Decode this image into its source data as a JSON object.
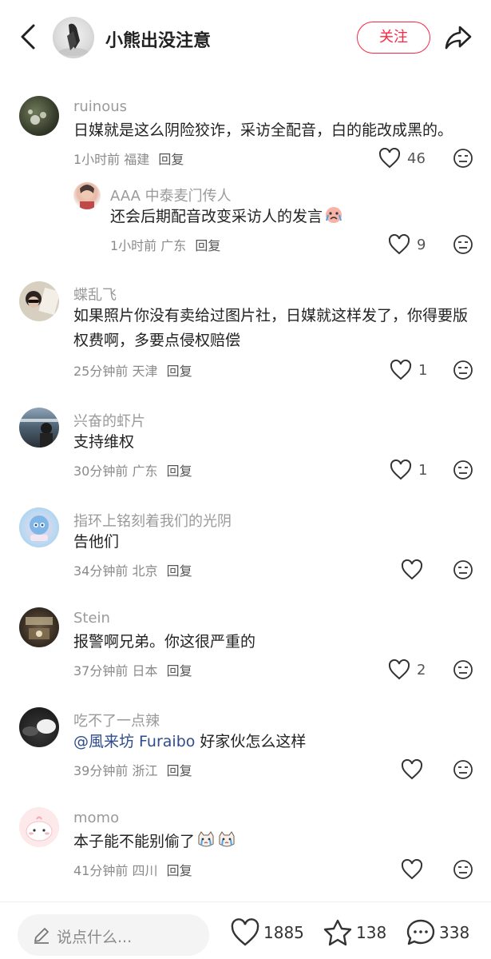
{
  "header": {
    "author_name": "小熊出没注意",
    "follow_label": "关注",
    "accent": "#ff2442"
  },
  "comments": [
    {
      "username": "ruinous",
      "text": "日媒就是这么阴险狡诈，采访全配音，白的能改成黑的。",
      "time": "1小时前",
      "location": "福建",
      "reply": "回复",
      "likes": "46",
      "replies": [
        {
          "username": "AAA 中泰麦门传人",
          "text": "还会后期配音改变采访人的发言",
          "emoji": "crying-face",
          "time": "1小时前",
          "location": "广东",
          "reply": "回复",
          "likes": "9"
        }
      ]
    },
    {
      "username": "蝶乱飞",
      "text": "如果照片你没有卖给过图片社，日媒就这样发了，你得要版权费啊，多要点侵权赔偿",
      "time": "25分钟前",
      "location": "天津",
      "reply": "回复",
      "likes": "1"
    },
    {
      "username": "兴奋的虾片",
      "text": "支持维权",
      "time": "30分钟前",
      "location": "广东",
      "reply": "回复",
      "likes": "1"
    },
    {
      "username": "指环上铭刻着我们的光阴",
      "text": "告他们",
      "time": "34分钟前",
      "location": "北京",
      "reply": "回复",
      "likes": ""
    },
    {
      "username": "Stein",
      "text": "报警啊兄弟。你这很严重的",
      "time": "37分钟前",
      "location": "日本",
      "reply": "回复",
      "likes": "2"
    },
    {
      "username": "吃不了一点辣",
      "mention": "@風来坊 Furaibo",
      "text": " 好家伙怎么这样",
      "time": "39分钟前",
      "location": "浙江",
      "reply": "回复",
      "likes": ""
    },
    {
      "username": "momo",
      "text": "本子能不能别偷了",
      "emoji": "crying-cat",
      "time": "41分钟前",
      "location": "四川",
      "reply": "回复",
      "likes": ""
    }
  ],
  "bottom_bar": {
    "input_placeholder": "说点什么...",
    "likes": "1885",
    "favorites": "138",
    "comments": "338"
  }
}
